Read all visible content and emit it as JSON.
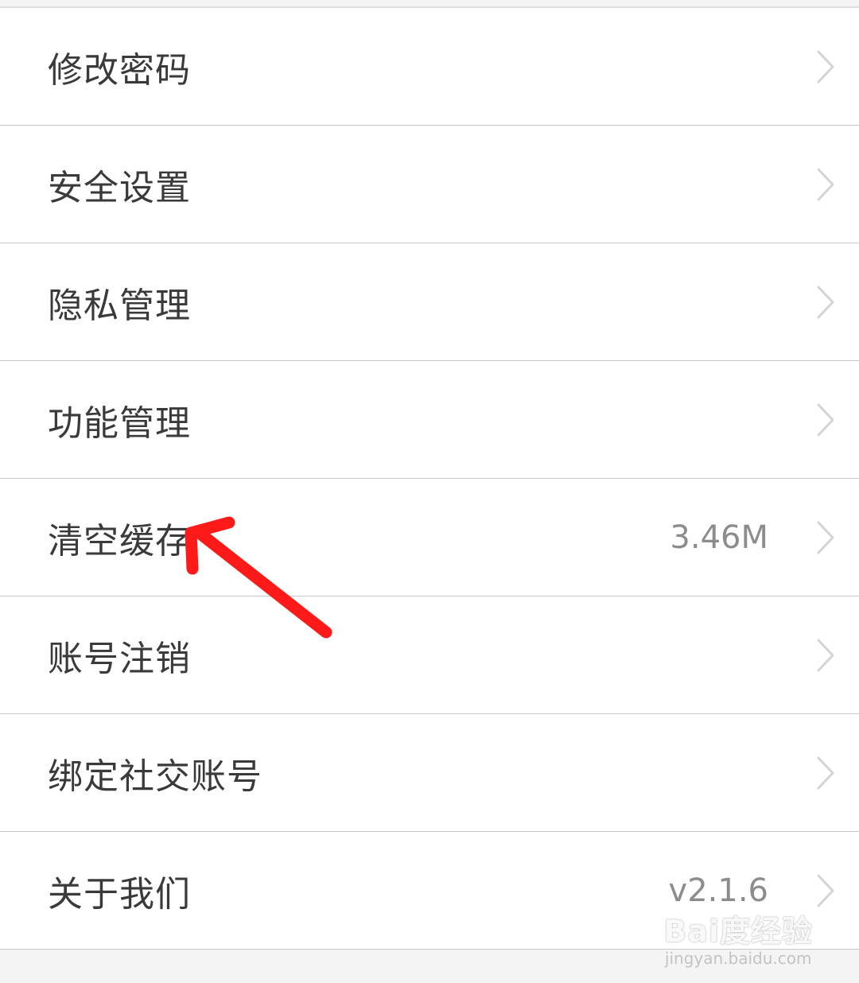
{
  "settings": {
    "items": [
      {
        "label": "修改密码",
        "value": ""
      },
      {
        "label": "安全设置",
        "value": ""
      },
      {
        "label": "隐私管理",
        "value": ""
      },
      {
        "label": "功能管理",
        "value": ""
      },
      {
        "label": "清空缓存",
        "value": "3.46M"
      },
      {
        "label": "账号注销",
        "value": ""
      },
      {
        "label": "绑定社交账号",
        "value": ""
      },
      {
        "label": "关于我们",
        "value": "v2.1.6"
      }
    ]
  },
  "annotation": {
    "color": "#ff1a1a",
    "points_to": "清空缓存"
  },
  "watermark": {
    "main": "Bai度经验",
    "sub": "jingyan.baidu.com"
  },
  "icons": {
    "row_chevron": "chevron-right-icon"
  }
}
